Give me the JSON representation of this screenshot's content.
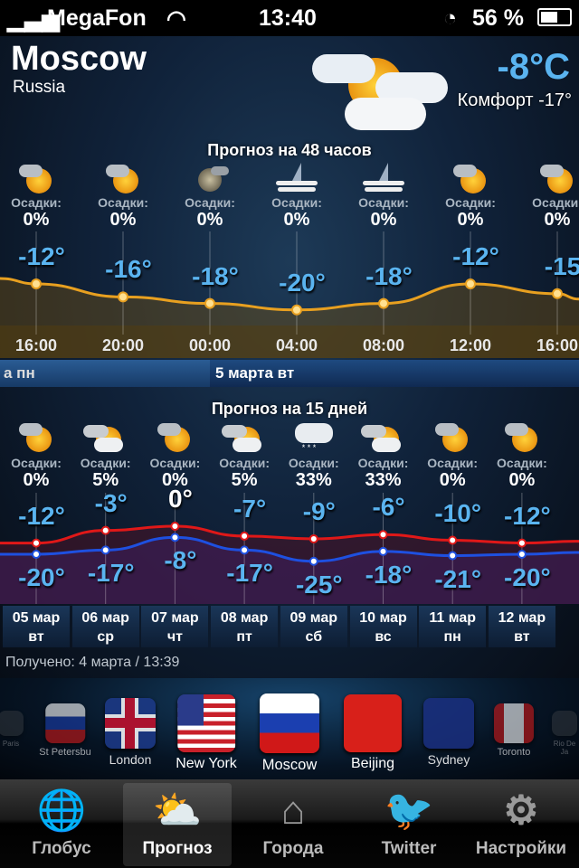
{
  "status": {
    "carrier": "MegaFon",
    "time": "13:40",
    "battery": "56 %",
    "icons": [
      "signal-icon",
      "wifi-icon",
      "clock-icon",
      "battery-icon"
    ]
  },
  "location": {
    "city": "Moscow",
    "country": "Russia",
    "temp": "-8°C",
    "comfort": "Комфорт -17°",
    "icon": "sun-cloud-icon"
  },
  "hourly": {
    "title": "Прогноз на 48 часов",
    "precip_label": "Осадки:",
    "items": [
      {
        "time": "16:00",
        "temp": -12,
        "temp_label": "-12°",
        "precip": "0%",
        "icon": "sun-cloud"
      },
      {
        "time": "20:00",
        "temp": -16,
        "temp_label": "-16°",
        "precip": "0%",
        "icon": "sun-cloud"
      },
      {
        "time": "00:00",
        "temp": -18,
        "temp_label": "-18°",
        "precip": "0%",
        "icon": "moon-cloud"
      },
      {
        "time": "04:00",
        "temp": -20,
        "temp_label": "-20°",
        "precip": "0%",
        "icon": "moon-fog"
      },
      {
        "time": "08:00",
        "temp": -18,
        "temp_label": "-18°",
        "precip": "0%",
        "icon": "moon-fog"
      },
      {
        "time": "12:00",
        "temp": -12,
        "temp_label": "-12°",
        "precip": "0%",
        "icon": "sun-cloud"
      },
      {
        "time": "16:00",
        "temp": -15,
        "temp_label": "-15",
        "precip": "0%",
        "icon": "sun-cloud"
      }
    ],
    "date_prev": "а пн",
    "date_next": "5 марта вт"
  },
  "daily": {
    "title": "Прогноз на 15 дней",
    "precip_label": "Осадки:",
    "items": [
      {
        "date": "05 мар",
        "dow": "вт",
        "high": -12,
        "low": -20,
        "high_label": "-12°",
        "low_label": "-20°",
        "precip": "0%",
        "icon": "sun-cloud"
      },
      {
        "date": "06 мар",
        "dow": "ср",
        "high": -3,
        "low": -17,
        "high_label": "-3°",
        "low_label": "-17°",
        "precip": "5%",
        "icon": "partly-cloudy"
      },
      {
        "date": "07 мар",
        "dow": "чт",
        "high": 0,
        "low": -8,
        "high_label": "0°",
        "low_label": "-8°",
        "precip": "0%",
        "icon": "sun-cloud"
      },
      {
        "date": "08 мар",
        "dow": "пт",
        "high": -7,
        "low": -17,
        "high_label": "-7°",
        "low_label": "-17°",
        "precip": "5%",
        "icon": "partly-cloudy"
      },
      {
        "date": "09 мар",
        "dow": "сб",
        "high": -9,
        "low": -25,
        "high_label": "-9°",
        "low_label": "-25°",
        "precip": "33%",
        "icon": "snow"
      },
      {
        "date": "10 мар",
        "dow": "вс",
        "high": -6,
        "low": -18,
        "high_label": "-6°",
        "low_label": "-18°",
        "precip": "33%",
        "icon": "partly-cloudy"
      },
      {
        "date": "11 мар",
        "dow": "пн",
        "high": -10,
        "low": -21,
        "high_label": "-10°",
        "low_label": "-21°",
        "precip": "0%",
        "icon": "sun-cloud"
      },
      {
        "date": "12 мар",
        "dow": "вт",
        "high": -12,
        "low": -20,
        "high_label": "-12°",
        "low_label": "-20°",
        "precip": "0%",
        "icon": "sun-cloud"
      }
    ],
    "received": "Получено: 4 марта / 13:39",
    "colors": {
      "high": "#e01818",
      "low": "#1e50e0"
    }
  },
  "cities": [
    {
      "name": "Paris"
    },
    {
      "name": "St Petersbu",
      "flag": "ru"
    },
    {
      "name": "London",
      "flag": "uk"
    },
    {
      "name": "New York",
      "flag": "us"
    },
    {
      "name": "Moscow",
      "flag": "ru"
    },
    {
      "name": "Beijing",
      "flag": "cn"
    },
    {
      "name": "Sydney",
      "flag": "au"
    },
    {
      "name": "Toronto",
      "flag": "ca"
    },
    {
      "name": "Rio De Ja"
    }
  ],
  "tabs": [
    {
      "label": "Глобус",
      "icon": "globe-icon"
    },
    {
      "label": "Прогноз",
      "icon": "forecast-icon",
      "selected": true
    },
    {
      "label": "Города",
      "icon": "city-search-icon"
    },
    {
      "label": "Twitter",
      "icon": "twitter-icon"
    },
    {
      "label": "Настройки",
      "icon": "gears-icon"
    }
  ]
}
